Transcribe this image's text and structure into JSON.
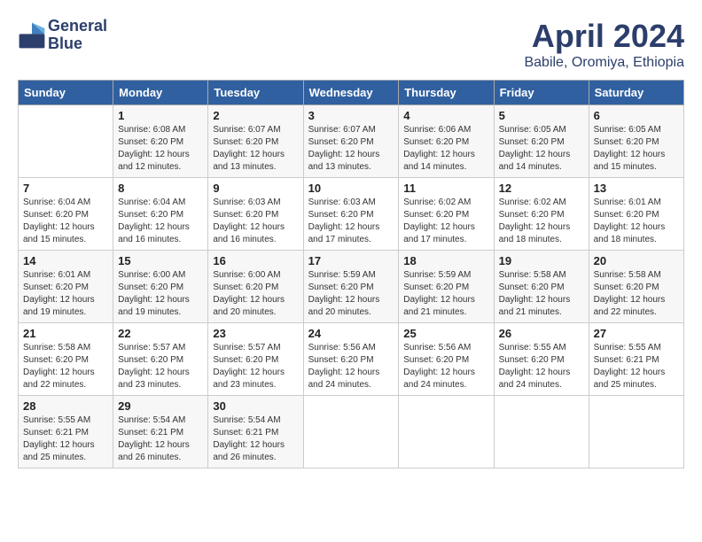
{
  "header": {
    "logo_line1": "General",
    "logo_line2": "Blue",
    "month": "April 2024",
    "location": "Babile, Oromiya, Ethiopia"
  },
  "days_of_week": [
    "Sunday",
    "Monday",
    "Tuesday",
    "Wednesday",
    "Thursday",
    "Friday",
    "Saturday"
  ],
  "weeks": [
    [
      {
        "day": "",
        "info": ""
      },
      {
        "day": "1",
        "info": "Sunrise: 6:08 AM\nSunset: 6:20 PM\nDaylight: 12 hours\nand 12 minutes."
      },
      {
        "day": "2",
        "info": "Sunrise: 6:07 AM\nSunset: 6:20 PM\nDaylight: 12 hours\nand 13 minutes."
      },
      {
        "day": "3",
        "info": "Sunrise: 6:07 AM\nSunset: 6:20 PM\nDaylight: 12 hours\nand 13 minutes."
      },
      {
        "day": "4",
        "info": "Sunrise: 6:06 AM\nSunset: 6:20 PM\nDaylight: 12 hours\nand 14 minutes."
      },
      {
        "day": "5",
        "info": "Sunrise: 6:05 AM\nSunset: 6:20 PM\nDaylight: 12 hours\nand 14 minutes."
      },
      {
        "day": "6",
        "info": "Sunrise: 6:05 AM\nSunset: 6:20 PM\nDaylight: 12 hours\nand 15 minutes."
      }
    ],
    [
      {
        "day": "7",
        "info": "Sunrise: 6:04 AM\nSunset: 6:20 PM\nDaylight: 12 hours\nand 15 minutes."
      },
      {
        "day": "8",
        "info": "Sunrise: 6:04 AM\nSunset: 6:20 PM\nDaylight: 12 hours\nand 16 minutes."
      },
      {
        "day": "9",
        "info": "Sunrise: 6:03 AM\nSunset: 6:20 PM\nDaylight: 12 hours\nand 16 minutes."
      },
      {
        "day": "10",
        "info": "Sunrise: 6:03 AM\nSunset: 6:20 PM\nDaylight: 12 hours\nand 17 minutes."
      },
      {
        "day": "11",
        "info": "Sunrise: 6:02 AM\nSunset: 6:20 PM\nDaylight: 12 hours\nand 17 minutes."
      },
      {
        "day": "12",
        "info": "Sunrise: 6:02 AM\nSunset: 6:20 PM\nDaylight: 12 hours\nand 18 minutes."
      },
      {
        "day": "13",
        "info": "Sunrise: 6:01 AM\nSunset: 6:20 PM\nDaylight: 12 hours\nand 18 minutes."
      }
    ],
    [
      {
        "day": "14",
        "info": "Sunrise: 6:01 AM\nSunset: 6:20 PM\nDaylight: 12 hours\nand 19 minutes."
      },
      {
        "day": "15",
        "info": "Sunrise: 6:00 AM\nSunset: 6:20 PM\nDaylight: 12 hours\nand 19 minutes."
      },
      {
        "day": "16",
        "info": "Sunrise: 6:00 AM\nSunset: 6:20 PM\nDaylight: 12 hours\nand 20 minutes."
      },
      {
        "day": "17",
        "info": "Sunrise: 5:59 AM\nSunset: 6:20 PM\nDaylight: 12 hours\nand 20 minutes."
      },
      {
        "day": "18",
        "info": "Sunrise: 5:59 AM\nSunset: 6:20 PM\nDaylight: 12 hours\nand 21 minutes."
      },
      {
        "day": "19",
        "info": "Sunrise: 5:58 AM\nSunset: 6:20 PM\nDaylight: 12 hours\nand 21 minutes."
      },
      {
        "day": "20",
        "info": "Sunrise: 5:58 AM\nSunset: 6:20 PM\nDaylight: 12 hours\nand 22 minutes."
      }
    ],
    [
      {
        "day": "21",
        "info": "Sunrise: 5:58 AM\nSunset: 6:20 PM\nDaylight: 12 hours\nand 22 minutes."
      },
      {
        "day": "22",
        "info": "Sunrise: 5:57 AM\nSunset: 6:20 PM\nDaylight: 12 hours\nand 23 minutes."
      },
      {
        "day": "23",
        "info": "Sunrise: 5:57 AM\nSunset: 6:20 PM\nDaylight: 12 hours\nand 23 minutes."
      },
      {
        "day": "24",
        "info": "Sunrise: 5:56 AM\nSunset: 6:20 PM\nDaylight: 12 hours\nand 24 minutes."
      },
      {
        "day": "25",
        "info": "Sunrise: 5:56 AM\nSunset: 6:20 PM\nDaylight: 12 hours\nand 24 minutes."
      },
      {
        "day": "26",
        "info": "Sunrise: 5:55 AM\nSunset: 6:20 PM\nDaylight: 12 hours\nand 24 minutes."
      },
      {
        "day": "27",
        "info": "Sunrise: 5:55 AM\nSunset: 6:21 PM\nDaylight: 12 hours\nand 25 minutes."
      }
    ],
    [
      {
        "day": "28",
        "info": "Sunrise: 5:55 AM\nSunset: 6:21 PM\nDaylight: 12 hours\nand 25 minutes."
      },
      {
        "day": "29",
        "info": "Sunrise: 5:54 AM\nSunset: 6:21 PM\nDaylight: 12 hours\nand 26 minutes."
      },
      {
        "day": "30",
        "info": "Sunrise: 5:54 AM\nSunset: 6:21 PM\nDaylight: 12 hours\nand 26 minutes."
      },
      {
        "day": "",
        "info": ""
      },
      {
        "day": "",
        "info": ""
      },
      {
        "day": "",
        "info": ""
      },
      {
        "day": "",
        "info": ""
      }
    ]
  ]
}
